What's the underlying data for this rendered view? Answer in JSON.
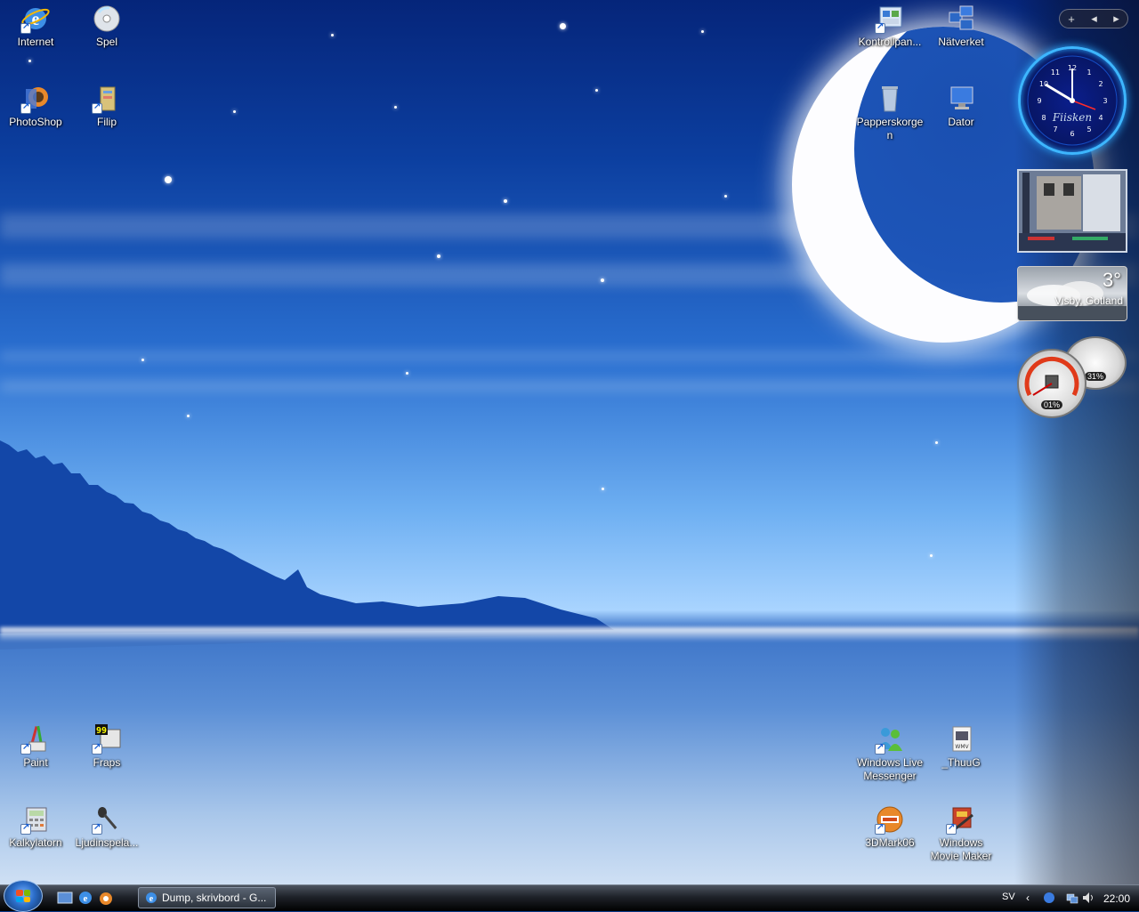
{
  "desktop": {
    "icons_left": [
      {
        "name": "internet",
        "label": "Internet",
        "icon": "ie-icon"
      },
      {
        "name": "spel",
        "label": "Spel",
        "icon": "cd-icon"
      },
      {
        "name": "photoshop",
        "label": "PhotoShop",
        "icon": "photoshop-icon"
      },
      {
        "name": "filip",
        "label": "Filip",
        "icon": "folder-icon"
      },
      {
        "name": "paint",
        "label": "Paint",
        "icon": "paint-icon"
      },
      {
        "name": "fraps",
        "label": "Fraps",
        "icon": "fraps-icon"
      },
      {
        "name": "kalkylatorn",
        "label": "Kalkylatorn",
        "icon": "calculator-icon"
      },
      {
        "name": "ljudinspelaren",
        "label": "Ljudinspela...",
        "icon": "microphone-icon"
      }
    ],
    "icons_right": [
      {
        "name": "kontrollpanelen",
        "label": "Kontrollpan...",
        "icon": "control-panel-icon"
      },
      {
        "name": "natverket",
        "label": "Nätverket",
        "icon": "network-icon"
      },
      {
        "name": "papperskorgen",
        "label": "Papperskorge n",
        "icon": "recycle-bin-icon"
      },
      {
        "name": "dator",
        "label": "Dator",
        "icon": "computer-icon"
      },
      {
        "name": "windows-live-messenger",
        "label": "Windows Live Messenger",
        "icon": "messenger-icon"
      },
      {
        "name": "thuug",
        "label": "_ThuuG",
        "icon": "wmv-file-icon"
      },
      {
        "name": "3dmark06",
        "label": "3DMark06",
        "icon": "3dmark-icon"
      },
      {
        "name": "windows-movie-maker",
        "label": "Windows Movie Maker",
        "icon": "movie-maker-icon"
      }
    ]
  },
  "sidebar": {
    "controls": {
      "add": "+",
      "prev": "◂",
      "next": "▸"
    },
    "clock": {
      "brand": "Fiisken",
      "time": "22:00"
    },
    "weather": {
      "temperature": "3°",
      "location": "Visby, Gotland"
    },
    "meters": {
      "cpu": "01%",
      "memory": "31%"
    }
  },
  "taskbar": {
    "task_label": "Dump, skrivbord - G...",
    "language": "SV",
    "clock": "22:00"
  },
  "colors": {
    "sky_top": "#05257a",
    "clock_ring": "#3db6ff",
    "taskbar": "#1e2229"
  }
}
